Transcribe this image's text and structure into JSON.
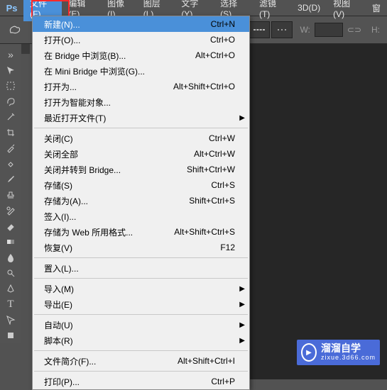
{
  "app": {
    "logo": "Ps"
  },
  "menubar": {
    "items": [
      {
        "label": "文件(F)",
        "active": true
      },
      {
        "label": "编辑(E)"
      },
      {
        "label": "图像(I)"
      },
      {
        "label": "图层(L)"
      },
      {
        "label": "文字(Y)"
      },
      {
        "label": "选择(S)"
      },
      {
        "label": "滤镜(T)"
      },
      {
        "label": "3D(D)"
      },
      {
        "label": "视图(V)"
      },
      {
        "label": "窗"
      }
    ]
  },
  "options": {
    "width_label": "W:",
    "height_label": "H:"
  },
  "dropdown": {
    "items": [
      {
        "type": "item",
        "label": "新建(N)...",
        "shortcut": "Ctrl+N",
        "highlighted": true
      },
      {
        "type": "item",
        "label": "打开(O)...",
        "shortcut": "Ctrl+O"
      },
      {
        "type": "item",
        "label": "在 Bridge 中浏览(B)...",
        "shortcut": "Alt+Ctrl+O"
      },
      {
        "type": "item",
        "label": "在 Mini Bridge 中浏览(G)..."
      },
      {
        "type": "item",
        "label": "打开为...",
        "shortcut": "Alt+Shift+Ctrl+O"
      },
      {
        "type": "item",
        "label": "打开为智能对象..."
      },
      {
        "type": "item",
        "label": "最近打开文件(T)",
        "submenu": true
      },
      {
        "type": "sep"
      },
      {
        "type": "item",
        "label": "关闭(C)",
        "shortcut": "Ctrl+W"
      },
      {
        "type": "item",
        "label": "关闭全部",
        "shortcut": "Alt+Ctrl+W"
      },
      {
        "type": "item",
        "label": "关闭并转到 Bridge...",
        "shortcut": "Shift+Ctrl+W"
      },
      {
        "type": "item",
        "label": "存储(S)",
        "shortcut": "Ctrl+S"
      },
      {
        "type": "item",
        "label": "存储为(A)...",
        "shortcut": "Shift+Ctrl+S"
      },
      {
        "type": "item",
        "label": "签入(I)..."
      },
      {
        "type": "item",
        "label": "存储为 Web 所用格式...",
        "shortcut": "Alt+Shift+Ctrl+S"
      },
      {
        "type": "item",
        "label": "恢复(V)",
        "shortcut": "F12"
      },
      {
        "type": "sep"
      },
      {
        "type": "item",
        "label": "置入(L)..."
      },
      {
        "type": "sep"
      },
      {
        "type": "item",
        "label": "导入(M)",
        "submenu": true
      },
      {
        "type": "item",
        "label": "导出(E)",
        "submenu": true
      },
      {
        "type": "sep"
      },
      {
        "type": "item",
        "label": "自动(U)",
        "submenu": true
      },
      {
        "type": "item",
        "label": "脚本(R)",
        "submenu": true
      },
      {
        "type": "sep"
      },
      {
        "type": "item",
        "label": "文件简介(F)...",
        "shortcut": "Alt+Shift+Ctrl+I"
      },
      {
        "type": "sep"
      },
      {
        "type": "item",
        "label": "打印(P)...",
        "shortcut": "Ctrl+P"
      }
    ]
  },
  "watermark": {
    "main": "溜溜自学",
    "sub": "zixue.3d66.com"
  }
}
